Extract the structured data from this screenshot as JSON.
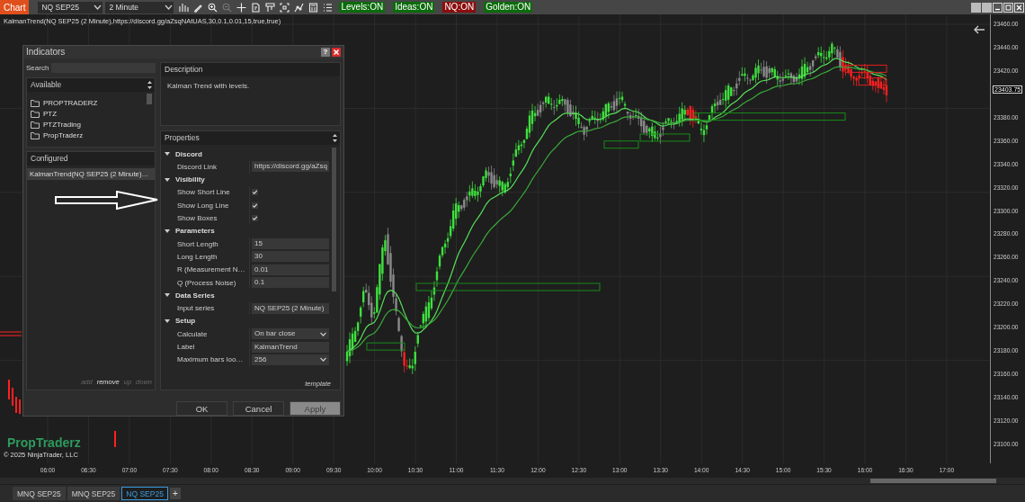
{
  "toolbar": {
    "chart_button": "Chart",
    "instrument": "NQ SEP25",
    "interval": "2 Minute",
    "tools": [
      {
        "disabled": false
      },
      {
        "disabled": false
      },
      {
        "disabled": false
      },
      {
        "disabled": true
      },
      {
        "disabled": false
      },
      {
        "disabled": false
      },
      {
        "disabled": false
      },
      {
        "disabled": false
      },
      {
        "disabled": false
      },
      {
        "disabled": false
      },
      {
        "disabled": false
      }
    ],
    "toggles": [
      {
        "label": "Levels:ON",
        "color": "#0b6b0b"
      },
      {
        "label": "Ideas:ON",
        "color": "#0b6b0b"
      },
      {
        "label": "NQ:ON",
        "color": "#8b0d0d"
      },
      {
        "label": "Golden:ON",
        "color": "#0b6b0b"
      }
    ]
  },
  "indicator_label": "KalmanTrend(NQ SEP25 (2 Minute),https://discord.gg/aZsqNAtUAS,30,0.1,0.01,15,true,true)",
  "branding": {
    "title": "PropTraderz",
    "copyright": "© 2025 NinjaTrader, LLC"
  },
  "price_axis": {
    "current_price": "23403.75",
    "labels": [
      "23460.00",
      "23440.00",
      "23420.00",
      "23380.00",
      "23360.00",
      "23340.00",
      "23320.00",
      "23300.00",
      "23280.00",
      "23260.00",
      "23240.00",
      "23220.00",
      "23200.00",
      "23180.00",
      "23160.00",
      "23140.00",
      "23120.00",
      "23100.00"
    ]
  },
  "time_axis": {
    "labels": [
      "06:00",
      "06:30",
      "07:00",
      "07:30",
      "08:00",
      "08:30",
      "09:00",
      "09:30",
      "10:00",
      "10:30",
      "11:00",
      "11:30",
      "12:00",
      "12:30",
      "13:00",
      "13:30",
      "14:00",
      "14:30",
      "15:00",
      "15:30",
      "16:00",
      "16:30",
      "17:00"
    ]
  },
  "dialog": {
    "title": "Indicators",
    "help": "?",
    "search_label": "Search",
    "available": {
      "header": "Available",
      "items": [
        "PROPTRADERZ",
        "PTZ",
        "PTZTrading",
        "PropTraderz"
      ]
    },
    "configured": {
      "header": "Configured",
      "items": [
        {
          "label": "KalmanTrend(NQ SEP25 (2 Minute)…",
          "selected": true
        }
      ],
      "actions": [
        {
          "label": "add",
          "disabled": true
        },
        {
          "label": "remove",
          "disabled": false
        },
        {
          "label": "up",
          "disabled": true
        },
        {
          "label": "down",
          "disabled": true
        }
      ]
    },
    "description": {
      "header": "Description",
      "text": "Kalman Trend with levels."
    },
    "properties": {
      "header": "Properties",
      "template": "template",
      "groups": [
        {
          "name": "Discord",
          "expanded": true,
          "rows": [
            {
              "label": "Discord Link",
              "kind": "text",
              "value": "https://discord.gg/aZsq"
            }
          ]
        },
        {
          "name": "Visibility",
          "expanded": true,
          "rows": [
            {
              "label": "Show Short Line",
              "kind": "checkbox",
              "checked": true
            },
            {
              "label": "Show Long Line",
              "kind": "checkbox",
              "checked": true
            },
            {
              "label": "Show Boxes",
              "kind": "checkbox",
              "checked": true
            }
          ]
        },
        {
          "name": "Parameters",
          "expanded": true,
          "rows": [
            {
              "label": "Short Length",
              "kind": "text",
              "value": "15"
            },
            {
              "label": "Long Length",
              "kind": "text",
              "value": "30"
            },
            {
              "label": "R (Measurement N…",
              "kind": "text",
              "value": "0.01"
            },
            {
              "label": "Q (Process Noise)",
              "kind": "text",
              "value": "0.1"
            }
          ]
        },
        {
          "name": "Data Series",
          "expanded": true,
          "rows": [
            {
              "label": "Input series",
              "kind": "text",
              "value": "NQ SEP25 (2 Minute)"
            }
          ]
        },
        {
          "name": "Setup",
          "expanded": true,
          "rows": [
            {
              "label": "Calculate",
              "kind": "dropdown",
              "value": "On bar close"
            },
            {
              "label": "Label",
              "kind": "text",
              "value": "KalmanTrend"
            },
            {
              "label": "Maximum bars loo…",
              "kind": "dropdown",
              "value": "256"
            }
          ]
        }
      ]
    },
    "buttons": [
      {
        "label": "OK",
        "disabled": false
      },
      {
        "label": "Cancel",
        "disabled": false
      },
      {
        "label": "Apply",
        "disabled": true
      }
    ]
  },
  "tabs": [
    {
      "label": "MNQ SEP25",
      "selected": false
    },
    {
      "label": "MNQ SEP25",
      "selected": false
    },
    {
      "label": "NQ SEP25",
      "selected": true
    }
  ],
  "add_tab": "+"
}
